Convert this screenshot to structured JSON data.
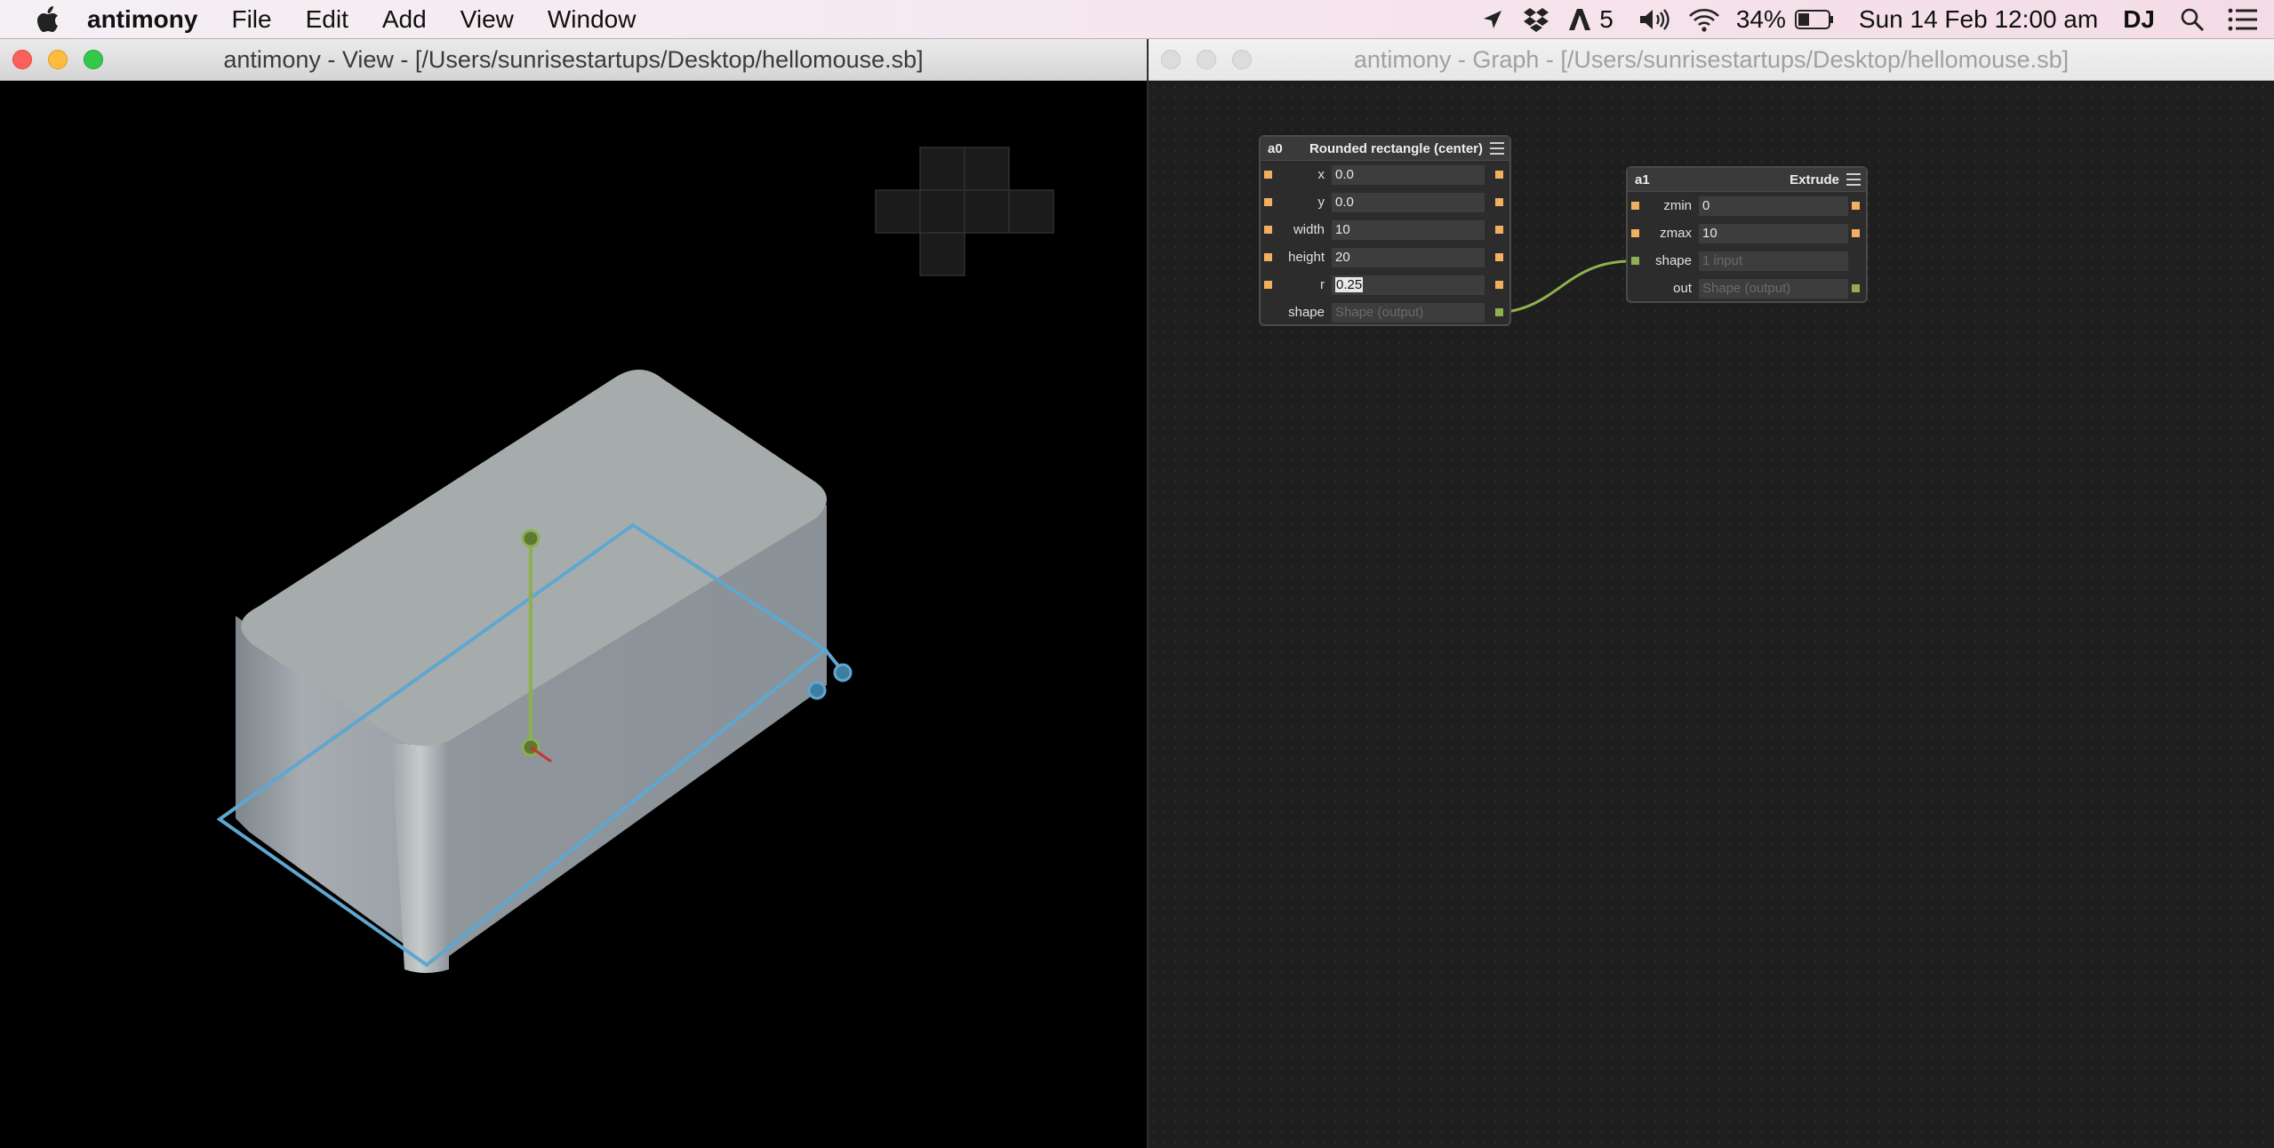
{
  "menubar": {
    "app_name": "antimony",
    "menus": [
      "File",
      "Edit",
      "Add",
      "View",
      "Window"
    ],
    "status": {
      "adobe_count": "5",
      "battery": "34%",
      "datetime": "Sun 14 Feb  12:00 am",
      "user": "DJ"
    }
  },
  "view_window": {
    "title": "antimony - View - [/Users/sunrisestartups/Desktop/hellomouse.sb]"
  },
  "graph_window": {
    "title": "antimony - Graph - [/Users/sunrisestartups/Desktop/hellomouse.sb]",
    "nodes": [
      {
        "id": "a0",
        "title": "Rounded rectangle (center)",
        "rows": [
          {
            "label": "x",
            "value": "0.0"
          },
          {
            "label": "y",
            "value": "0.0"
          },
          {
            "label": "width",
            "value": "10"
          },
          {
            "label": "height",
            "value": "20"
          },
          {
            "label": "r",
            "value": "0.25"
          },
          {
            "label": "shape",
            "value": "Shape (output)"
          }
        ]
      },
      {
        "id": "a1",
        "title": "Extrude",
        "rows": [
          {
            "label": "zmin",
            "value": "0"
          },
          {
            "label": "zmax",
            "value": "10"
          },
          {
            "label": "shape",
            "value": "1 input"
          },
          {
            "label": "out",
            "value": "Shape (output)"
          }
        ]
      }
    ]
  },
  "colors": {
    "port_float": "#f0b060",
    "port_shape": "#8fb050",
    "handle_blue": "#5fa7d0",
    "handle_green": "#8fb050"
  }
}
